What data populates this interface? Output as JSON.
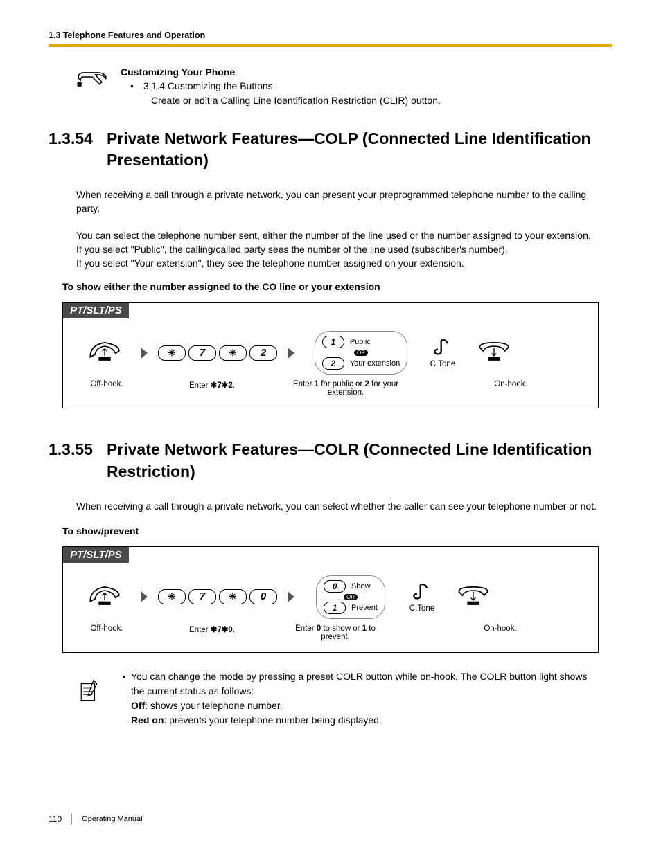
{
  "header": {
    "running": "1.3 Telephone Features and Operation"
  },
  "customize": {
    "title": "Customizing Your Phone",
    "line1": "3.1.4 Customizing the Buttons",
    "line2": "Create or edit a Calling Line Identification Restriction (CLIR) button."
  },
  "s54": {
    "num": "1.3.54",
    "title": "Private Network Features—COLP (Connected Line Identification Presentation)",
    "p1": "When receiving a call through a private network, you can present your preprogrammed telephone number to the calling party.",
    "p2": "You can select the telephone number sent, either the number of the line used or the number assigned to your extension.",
    "p3": "If you select \"Public\", the calling/called party sees the number of the line used (subscriber's number).",
    "p4": "If you select \"Your extension\", they see the telephone number assigned on your extension.",
    "sub": "To show either the number assigned to the CO line or your extension",
    "tab": "PT/SLT/PS",
    "keys": {
      "k2": "7",
      "k4": "2"
    },
    "choice": {
      "opt1key": "1",
      "opt1": "Public",
      "opt2key": "2",
      "opt2": "Your extension",
      "or": "OR"
    },
    "ctone": "C.Tone",
    "cap1": "Off-hook.",
    "cap2a": "Enter ",
    "cap2b": "7",
    "cap2c": "2",
    "cap2d": ".",
    "cap3a": "Enter ",
    "cap3b": "1",
    "cap3c": " for public or ",
    "cap3d": "2",
    "cap3e": " for your extension.",
    "cap4": "On-hook."
  },
  "s55": {
    "num": "1.3.55",
    "title": "Private Network Features—COLR (Connected Line Identification Restriction)",
    "p1": "When receiving a call through a private network, you can select whether the caller can see your telephone number or not.",
    "sub": "To show/prevent",
    "tab": "PT/SLT/PS",
    "keys": {
      "k2": "7",
      "k4": "0"
    },
    "choice": {
      "opt1key": "0",
      "opt1": "Show",
      "opt2key": "1",
      "opt2": "Prevent",
      "or": "OR"
    },
    "ctone": "C.Tone",
    "cap1": "Off-hook.",
    "cap2a": "Enter ",
    "cap2b": "7",
    "cap2c": "0",
    "cap2d": ".",
    "cap3a": "Enter ",
    "cap3b": "0",
    "cap3c": " to show or ",
    "cap3d": "1",
    "cap3e": " to prevent.",
    "cap4": "On-hook.",
    "note1": "You can change the mode by pressing a preset COLR button while on-hook. The COLR button light shows the current status as follows:",
    "note_off_lbl": "Off",
    "note_off": ": shows your telephone number.",
    "note_red_lbl": "Red on",
    "note_red": ": prevents your telephone number being displayed."
  },
  "footer": {
    "page": "110",
    "doc": "Operating Manual"
  }
}
